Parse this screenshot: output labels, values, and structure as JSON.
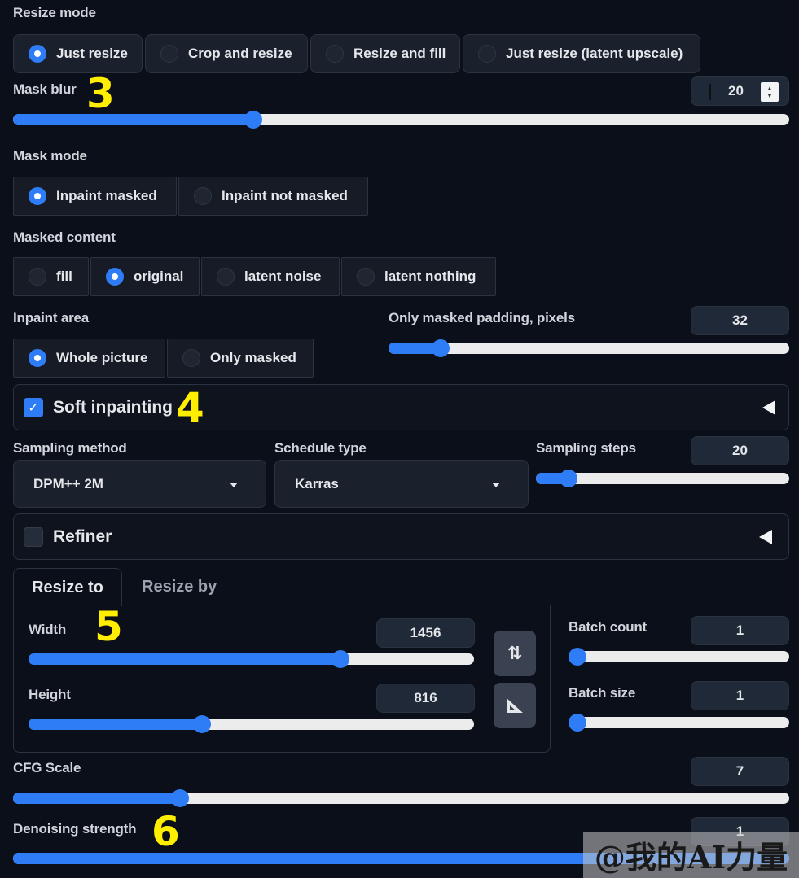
{
  "resize_mode": {
    "label": "Resize mode",
    "options": [
      "Just resize",
      "Crop and resize",
      "Resize and fill",
      "Just resize (latent upscale)"
    ],
    "selected": "Just resize"
  },
  "mask_blur": {
    "label": "Mask blur",
    "value": "20",
    "fraction": 0.31,
    "annotation": "3"
  },
  "mask_mode": {
    "label": "Mask mode",
    "options": [
      "Inpaint masked",
      "Inpaint not masked"
    ],
    "selected": "Inpaint masked"
  },
  "masked_content": {
    "label": "Masked content",
    "options": [
      "fill",
      "original",
      "latent noise",
      "latent nothing"
    ],
    "selected": "original"
  },
  "inpaint_area": {
    "label": "Inpaint area",
    "options": [
      "Whole picture",
      "Only masked"
    ],
    "selected": "Whole picture"
  },
  "only_masked_padding": {
    "label": "Only masked padding, pixels",
    "value": "32",
    "fraction": 0.13
  },
  "soft_inpainting": {
    "label": "Soft inpainting",
    "checked": true,
    "annotation": "4"
  },
  "sampling_method": {
    "label": "Sampling method",
    "value": "DPM++ 2M"
  },
  "schedule_type": {
    "label": "Schedule type",
    "value": "Karras"
  },
  "sampling_steps": {
    "label": "Sampling steps",
    "value": "20",
    "fraction": 0.13
  },
  "refiner": {
    "label": "Refiner",
    "checked": false
  },
  "resize_tabs": {
    "tabs": [
      "Resize to",
      "Resize by"
    ],
    "active": "Resize to",
    "annotation": "5"
  },
  "width": {
    "label": "Width",
    "value": "1456",
    "fraction": 0.7
  },
  "height": {
    "label": "Height",
    "value": "816",
    "fraction": 0.39
  },
  "swap_button": {
    "icon": "swap-arrows-icon",
    "glyph": "⇅"
  },
  "aspect_button": {
    "icon": "triangle-ruler-icon"
  },
  "batch_count": {
    "label": "Batch count",
    "value": "1",
    "fraction": 0.0
  },
  "batch_size": {
    "label": "Batch size",
    "value": "1",
    "fraction": 0.0
  },
  "cfg_scale": {
    "label": "CFG Scale",
    "value": "7",
    "fraction": 0.215
  },
  "denoising_strength": {
    "label": "Denoising strength",
    "value": "1",
    "fraction": 1.0,
    "annotation": "6"
  },
  "watermark": {
    "text": "@我的AI力量"
  },
  "colors": {
    "accent": "#2f7df6",
    "background": "#0b0f19",
    "annotation": "#ffee00"
  }
}
